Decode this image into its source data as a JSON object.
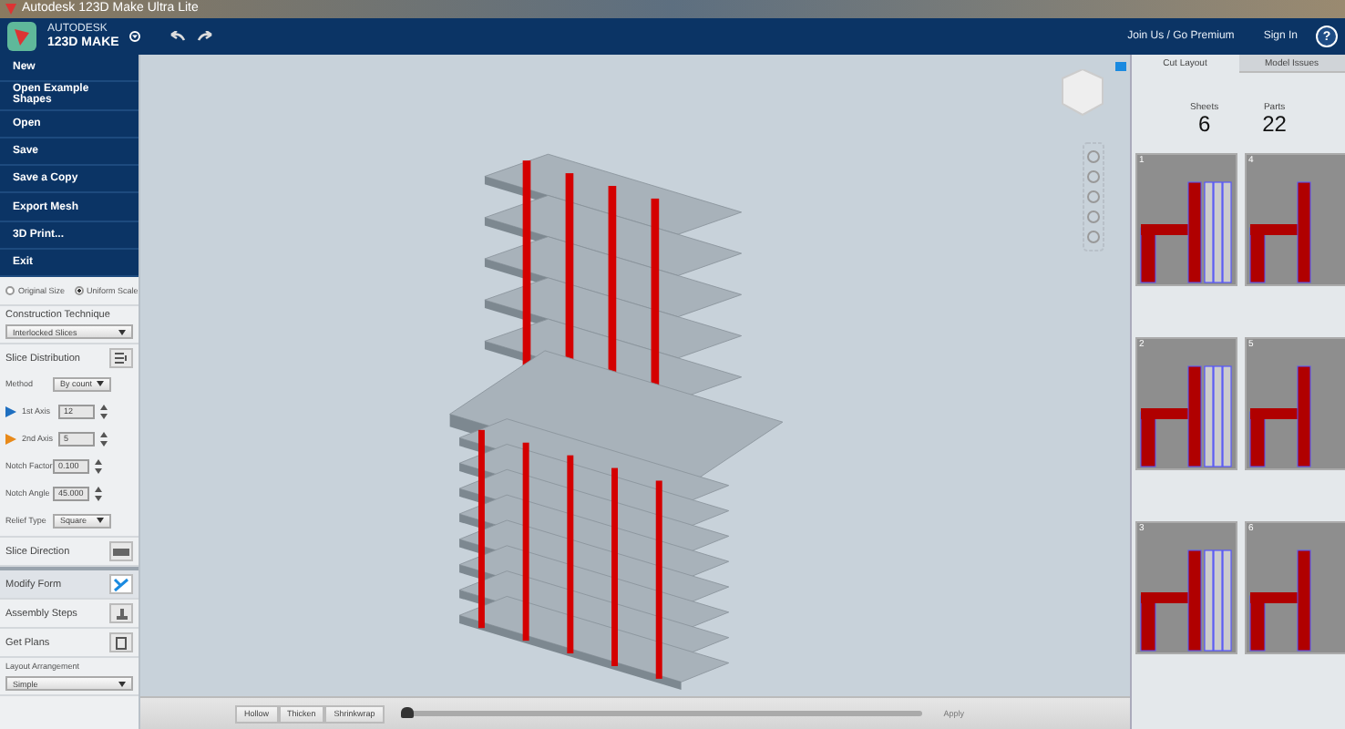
{
  "window": {
    "title": "Autodesk 123D Make Ultra Lite"
  },
  "header": {
    "brand_top": "AUTODESK",
    "brand_bottom": "123D MAKE",
    "links": [
      "Join Us / Go Premium",
      "Sign In"
    ],
    "help": "?"
  },
  "menu": [
    "New",
    "Open Example Shapes",
    "Open",
    "Save",
    "Save a Copy",
    "Export Mesh",
    "3D Print...",
    "Exit"
  ],
  "scale_options": [
    {
      "label": "Original Size",
      "selected": false
    },
    {
      "label": "Uniform Scale",
      "selected": true
    }
  ],
  "construction": {
    "label": "Construction Technique",
    "value": "Interlocked Slices"
  },
  "slice_distribution": {
    "title": "Slice Distribution",
    "fields": [
      {
        "kind": "select",
        "label": "Method",
        "value": "By count"
      },
      {
        "kind": "axis",
        "label": "1st Axis",
        "value": "12",
        "color": "#1e6fc0"
      },
      {
        "kind": "axis",
        "label": "2nd Axis",
        "value": "5",
        "color": "#e88a1a"
      },
      {
        "kind": "spin",
        "label": "Notch Factor",
        "value": "0.100"
      },
      {
        "kind": "spin",
        "label": "Notch Angle",
        "value": "45.000"
      },
      {
        "kind": "select",
        "label": "Relief Type",
        "value": "Square"
      }
    ]
  },
  "steps": [
    {
      "title": "Slice Direction",
      "selected": false
    },
    {
      "title": "Modify Form",
      "selected": true
    },
    {
      "title": "Assembly Steps",
      "selected": false
    },
    {
      "title": "Get Plans",
      "selected": false
    }
  ],
  "layout": {
    "label": "Layout Arrangement",
    "value": "Simple"
  },
  "tabs": [
    {
      "label": "Cut Layout",
      "selected": true
    },
    {
      "label": "Model Issues",
      "selected": false
    }
  ],
  "stats": [
    {
      "label": "Sheets",
      "value": "6"
    },
    {
      "label": "Parts",
      "value": "22"
    }
  ],
  "sheets": [
    {
      "number": "1"
    },
    {
      "number": "4"
    },
    {
      "number": "2"
    },
    {
      "number": "5"
    },
    {
      "number": "3"
    },
    {
      "number": "6"
    }
  ],
  "bottom_bar": {
    "buttons": [
      "Hollow",
      "Thicken",
      "Shrinkwrap"
    ],
    "slider": {
      "level": 0
    },
    "apply": {
      "label": "Apply",
      "disabled": true
    }
  }
}
